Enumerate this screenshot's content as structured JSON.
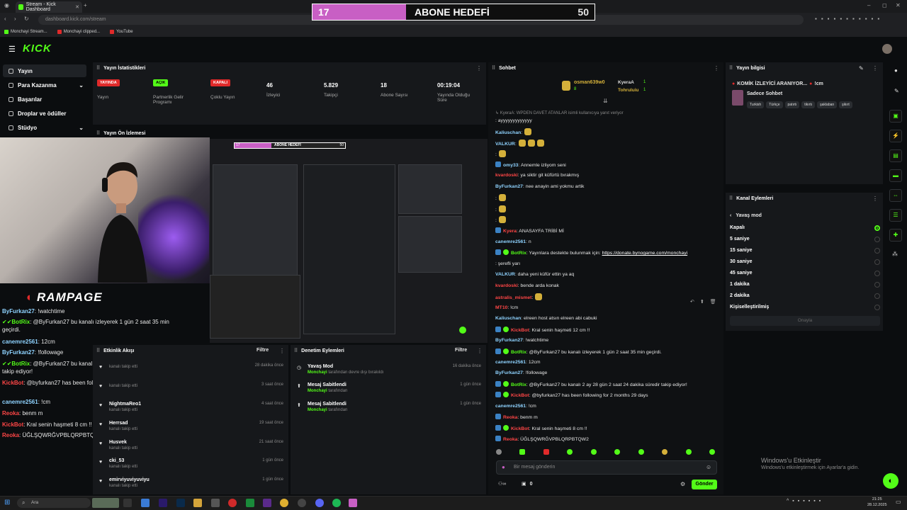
{
  "browser": {
    "tab_title": "Stream - Kick Dashboard",
    "url": "dashboard.kick.com/stream",
    "bookmarks": [
      "Monchayi Stream...",
      "Monchayi clipped...",
      "YouTube"
    ]
  },
  "sub_goal": {
    "current": "17",
    "label": "ABONE HEDEFİ",
    "target": "50",
    "progress": 0.34,
    "color": "#c85fc4"
  },
  "app": {
    "logo": "KICK",
    "accent": "#53fc18"
  },
  "sidebar": {
    "items": [
      {
        "label": "Yayın",
        "active": true,
        "icon": "video-icon"
      },
      {
        "label": "Para Kazanma",
        "icon": "money-icon",
        "expand": "chevron-down-icon"
      },
      {
        "label": "Başarılar",
        "icon": "trophy-icon"
      },
      {
        "label": "Droplar ve ödüller",
        "icon": "gift-icon"
      },
      {
        "label": "Stüdyo",
        "icon": "studio-icon",
        "expand": "chevron-down-icon"
      }
    ]
  },
  "stats": {
    "title": "Yayın İstatistikleri",
    "blocks": [
      {
        "badge": "YAYINDA",
        "badge_color": "#e02a2a",
        "label": "Yayın"
      },
      {
        "badge": "AÇIK",
        "badge_color": "#53fc18",
        "label": "Partnerlik Gelir Programı"
      },
      {
        "badge": "KAPALI",
        "badge_color": "#e02a2a",
        "label": "Çoklu Yayın"
      },
      {
        "value": "46",
        "label": "İzleyici"
      },
      {
        "value": "5.829",
        "label": "Takipçi"
      },
      {
        "value": "18",
        "label": "Abone Sayısı"
      },
      {
        "value": "00:19:04",
        "label": "Yayında Olduğu Süre"
      }
    ]
  },
  "preview": {
    "title": "Yayın Ön İzlemesi",
    "overlay_text": "RAMPAGE",
    "mini_goal": {
      "current": "17",
      "label": "ABONE HEDEFİ",
      "target": "50"
    }
  },
  "stream_chat": [
    {
      "user": "ByFurkan27",
      "msg": ": !watchtime",
      "style": "blue"
    },
    {
      "user": "BotRix",
      "msg": ": @ByFurkan27 bu kanalı izleyerek 1 gün 2 saat 35 min geçirdi.",
      "style": "bot"
    },
    {
      "user": "canemre2561",
      "msg": ": 12cm",
      "style": "blue"
    },
    {
      "user": "ByFurkan27",
      "msg": ": !followage",
      "style": "blue"
    },
    {
      "user": "BotRix",
      "msg": ": @ByFurkan27 bu kanalı 2 ay 28 gün 2 saat 24 dakika süredir takip ediyor!",
      "style": "bot"
    },
    {
      "user": "KickBot",
      "msg": ": @byfurkan27 has been following for 2 months 29 days",
      "style": "kickbot"
    },
    {
      "user": "canemre2561",
      "msg": ": !cm",
      "style": "blue"
    },
    {
      "user": "Reoka",
      "msg": ": benm m",
      "style": "red"
    },
    {
      "user": "KickBot",
      "msg": ": Kral senin haşmeti 8 cm !!",
      "style": "kickbot"
    },
    {
      "user": "Reoka",
      "msg": ": ÜĞLŞQWRĞVPBLQRPBTQW2",
      "style": "red"
    }
  ],
  "activity": {
    "title": "Etkinlik Akışı",
    "filter": "Filtre",
    "items": [
      {
        "name": "",
        "sub": "kanalı takip etti",
        "time": "28 dakika önce"
      },
      {
        "name": "",
        "sub": "kanalı takip etti",
        "time": "3 saat önce"
      },
      {
        "name": "NightmaReo1",
        "sub": "kanalı takip etti",
        "time": "4 saat önce"
      },
      {
        "name": "Herrsad",
        "sub": "kanalı takip etti",
        "time": "19 saat önce"
      },
      {
        "name": "Husvek",
        "sub": "kanalı takip etti",
        "time": "21 saat önce"
      },
      {
        "name": "cki_53",
        "sub": "kanalı takip etti",
        "time": "1 gün önce"
      },
      {
        "name": "emirviyuviyuviyu",
        "sub": "kanalı takip etti",
        "time": "1 gün önce"
      }
    ]
  },
  "moderation": {
    "title": "Denetim Eylemleri",
    "filter": "Filtre",
    "items": [
      {
        "name": "Yavaş Mod",
        "by": "Monchayi",
        "sub": "tarafından devre dışı bırakıldı",
        "time": "16 dakika önce",
        "icon": "clock-icon"
      },
      {
        "name": "Mesaj Sabitlendi",
        "by": "Monchayi",
        "sub": "tarafından",
        "time": "1 gün önce",
        "icon": "pin-icon"
      },
      {
        "name": "Mesaj Sabitlendi",
        "by": "Monchayi",
        "sub": "tarafından",
        "time": "1 gün önce",
        "icon": "pin-icon"
      }
    ]
  },
  "chat": {
    "title": "Sohbet",
    "top_gifters": [
      {
        "name": "osman639w0",
        "count": "8"
      },
      {
        "name": "KyeraA",
        "count": "1"
      },
      {
        "name": "Tohruluiu",
        "count": "1"
      }
    ],
    "reply_note": "KyeraA: WPDEN DAVET ATANLAR isimli kullanıcıya yanıt veriyor",
    "messages": [
      {
        "user": "",
        "msg": ": ayyyyyyyyyyyyy",
        "color": "#e6e6e6"
      },
      {
        "user": "Kaliuschan",
        "msg": ":",
        "color": "#8fd3ff",
        "emotes": 1
      },
      {
        "user": "VALKUR",
        "msg": ":",
        "color": "#8fd3ff",
        "emotes": 3
      },
      {
        "user": "",
        "msg": ":",
        "color": "#ff4646",
        "emotes": 1
      },
      {
        "user": "omy33",
        "msg": ": Annemle izliyom seni",
        "color": "#8fd3ff",
        "badge": "blue"
      },
      {
        "user": "kvardoski",
        "msg": ": ya siktir git küfürtü bırakmış",
        "color": "#ff4646"
      },
      {
        "user": "ByFurkan27",
        "msg": ": nee anayin ami yokmu artik",
        "color": "#8fd3ff"
      },
      {
        "user": "",
        "msg": ":",
        "color": "#ff4646",
        "emotes": 1
      },
      {
        "user": "",
        "msg": ":",
        "color": "#ff4646",
        "emotes": 1
      },
      {
        "user": "",
        "msg": ":",
        "color": "#ff4646",
        "emotes": 1
      },
      {
        "user": "Kyera",
        "msg": ": ANASAYFA TRİBİ Mİ",
        "color": "#ff4646",
        "badge": "blue"
      },
      {
        "user": "canemre2561",
        "msg": ": n",
        "color": "#8fd3ff"
      },
      {
        "user": "BotRix",
        "msg": ": Yayınlara destekte bulunmak için: ",
        "link": "https://donate.bynogame.com/monchayi",
        "color": "#53fc18",
        "badge": "bot"
      },
      {
        "user": "",
        "msg": ": şerefli yarı",
        "color": "#ff4646"
      },
      {
        "user": "VALKUR",
        "msg": ": daha yeni küfür ettin ya aq",
        "color": "#8fd3ff"
      },
      {
        "user": "kvardoski",
        "msg": ": bende arda konak",
        "color": "#ff4646"
      },
      {
        "user": "astralis_mismet",
        "msg": ":",
        "color": "#ff4646",
        "emotes": 1
      },
      {
        "user": "MT10",
        "msg": ": !cm",
        "color": "#ff4646"
      },
      {
        "user": "Kaliuschan",
        "msg": ": elreen host atsın elreen abi cabuki",
        "color": "#8fd3ff"
      },
      {
        "user": "KickBot",
        "msg": ": Kral senin haşmeti 12 cm !!",
        "color": "#ff4646",
        "badge": "bot"
      },
      {
        "user": "ByFurkan27",
        "msg": ": !watchtime",
        "color": "#8fd3ff"
      },
      {
        "user": "BotRix",
        "msg": ": @ByFurkan27 bu kanalı izleyerek 1 gün 2 saat 35 min geçirdi.",
        "color": "#53fc18",
        "badge": "bot"
      },
      {
        "user": "canemre2561",
        "msg": ": 12cm",
        "color": "#8fd3ff"
      },
      {
        "user": "ByFurkan27",
        "msg": ": !followage",
        "color": "#8fd3ff"
      },
      {
        "user": "BotRix",
        "msg": ": @ByFurkan27 bu kanalı 2 ay 28 gün 2 saat 24 dakika süredir takip ediyor!",
        "color": "#53fc18",
        "badge": "bot"
      },
      {
        "user": "KickBot",
        "msg": ": @byfurkan27 has been following for 2 months 29 days",
        "color": "#ff4646",
        "badge": "bot"
      },
      {
        "user": "canemre2561",
        "msg": ": !cm",
        "color": "#8fd3ff"
      },
      {
        "user": "Reoka",
        "msg": ": benm m",
        "color": "#ff4646",
        "badge": "blue"
      },
      {
        "user": "KickBot",
        "msg": ": Kral senin haşmeti 8 cm !!",
        "color": "#ff4646",
        "badge": "bot"
      },
      {
        "user": "Reoka",
        "msg": ": ÜĞLŞQWRĞVPBLQRPBTQW2",
        "color": "#ff4646",
        "badge": "blue"
      }
    ],
    "input_placeholder": "Bir mesaj gönderin",
    "points": "0",
    "send_label": "Gönder"
  },
  "stream_info": {
    "title": "Yayın bilgisi",
    "stream_title": "KOMİK İZLEYİCİ ARANIYOR...",
    "stream_title_suffix": "!cm",
    "category": "Sadece Sohbet",
    "tags": [
      "Turkish",
      "Türkçe",
      "patırtı",
      "tikırtı",
      "şaklaban",
      "şikırt"
    ]
  },
  "channel_actions": {
    "title": "Kanal Eylemleri",
    "back_label": "Yavaş mod",
    "options": [
      "Kapalı",
      "5 saniye",
      "15 saniye",
      "30 saniye",
      "45 saniye",
      "1 dakika",
      "2 dakika",
      "Kişiselleştirilmiş"
    ],
    "selected": 0,
    "confirm_label": "Onayla"
  },
  "windows": {
    "watermark_title": "Windows'u Etkinleştir",
    "watermark_sub": "Windows'u etkinleştirmek için Ayarlar'a gidin.",
    "search_placeholder": "Ara",
    "time": "21:25",
    "date": "28.12.2025"
  }
}
